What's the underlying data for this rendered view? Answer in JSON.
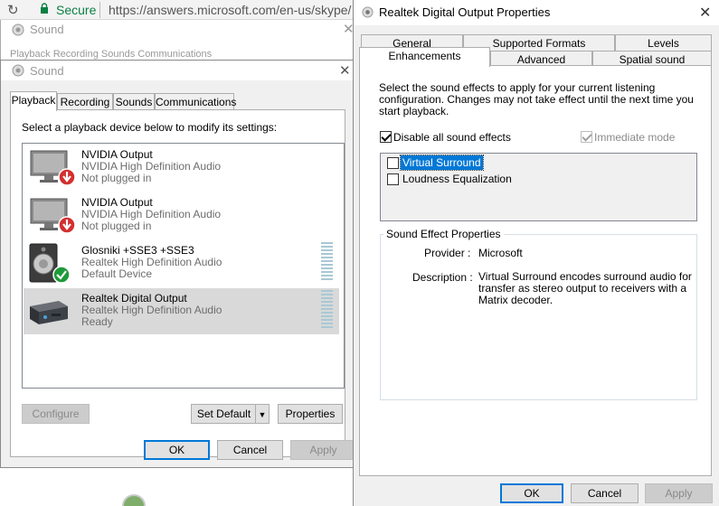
{
  "browser": {
    "secure_label": "Secure",
    "url": "https://answers.microsoft.com/en-us/skype/"
  },
  "sound_back": {
    "title": "Sound",
    "tabs_ghost": "Playback   Recording   Sounds   Communications"
  },
  "sound": {
    "title": "Sound",
    "tabs": [
      "Playback",
      "Recording",
      "Sounds",
      "Communications"
    ],
    "instruction": "Select a playback device below to modify its settings:",
    "devices": [
      {
        "name": "NVIDIA Output",
        "driver": "NVIDIA High Definition Audio",
        "status": "Not plugged in",
        "icon": "monitor-icon",
        "badge": "unplugged-badge-icon"
      },
      {
        "name": "NVIDIA Output",
        "driver": "NVIDIA High Definition Audio",
        "status": "Not plugged in",
        "icon": "monitor-icon",
        "badge": "unplugged-badge-icon"
      },
      {
        "name": "Glosniki +SSE3 +SSE3",
        "driver": "Realtek High Definition Audio",
        "status": "Default Device",
        "icon": "speaker-icon",
        "badge": "default-check-badge-icon"
      },
      {
        "name": "Realtek Digital Output",
        "driver": "Realtek High Definition Audio",
        "status": "Ready",
        "icon": "digital-output-icon",
        "selected": true
      }
    ],
    "buttons": {
      "configure": "Configure",
      "set_default": "Set Default",
      "properties": "Properties",
      "ok": "OK",
      "cancel": "Cancel",
      "apply": "Apply"
    }
  },
  "props": {
    "title": "Realtek Digital Output Properties",
    "tabs_row1": [
      "General",
      "Supported Formats",
      "Levels"
    ],
    "tabs_row2": [
      "Enhancements",
      "Advanced",
      "Spatial sound"
    ],
    "active_tab": "Enhancements",
    "description": "Select the sound effects to apply for your current listening configuration. Changes may not take effect until the next time you start playback.",
    "disable_all_label": "Disable all sound effects",
    "disable_all_checked": true,
    "immediate_mode_label": "Immediate mode",
    "immediate_mode_checked": true,
    "effects": [
      {
        "label": "Virtual Surround",
        "checked": false,
        "highlighted": true
      },
      {
        "label": "Loudness Equalization",
        "checked": false
      }
    ],
    "effect_properties": {
      "legend": "Sound Effect Properties",
      "provider_label": "Provider :",
      "provider_value": "Microsoft",
      "description_label": "Description :",
      "description_value": "Virtual Surround encodes surround audio for transfer as stereo output to receivers with a Matrix decoder."
    },
    "buttons": {
      "ok": "OK",
      "cancel": "Cancel",
      "apply": "Apply"
    }
  },
  "colors": {
    "accent": "#0078d7",
    "selection": "#0078d7",
    "unplugged": "#d32f2f",
    "default_ok": "#1f9a3a",
    "secure": "#0b8043"
  }
}
